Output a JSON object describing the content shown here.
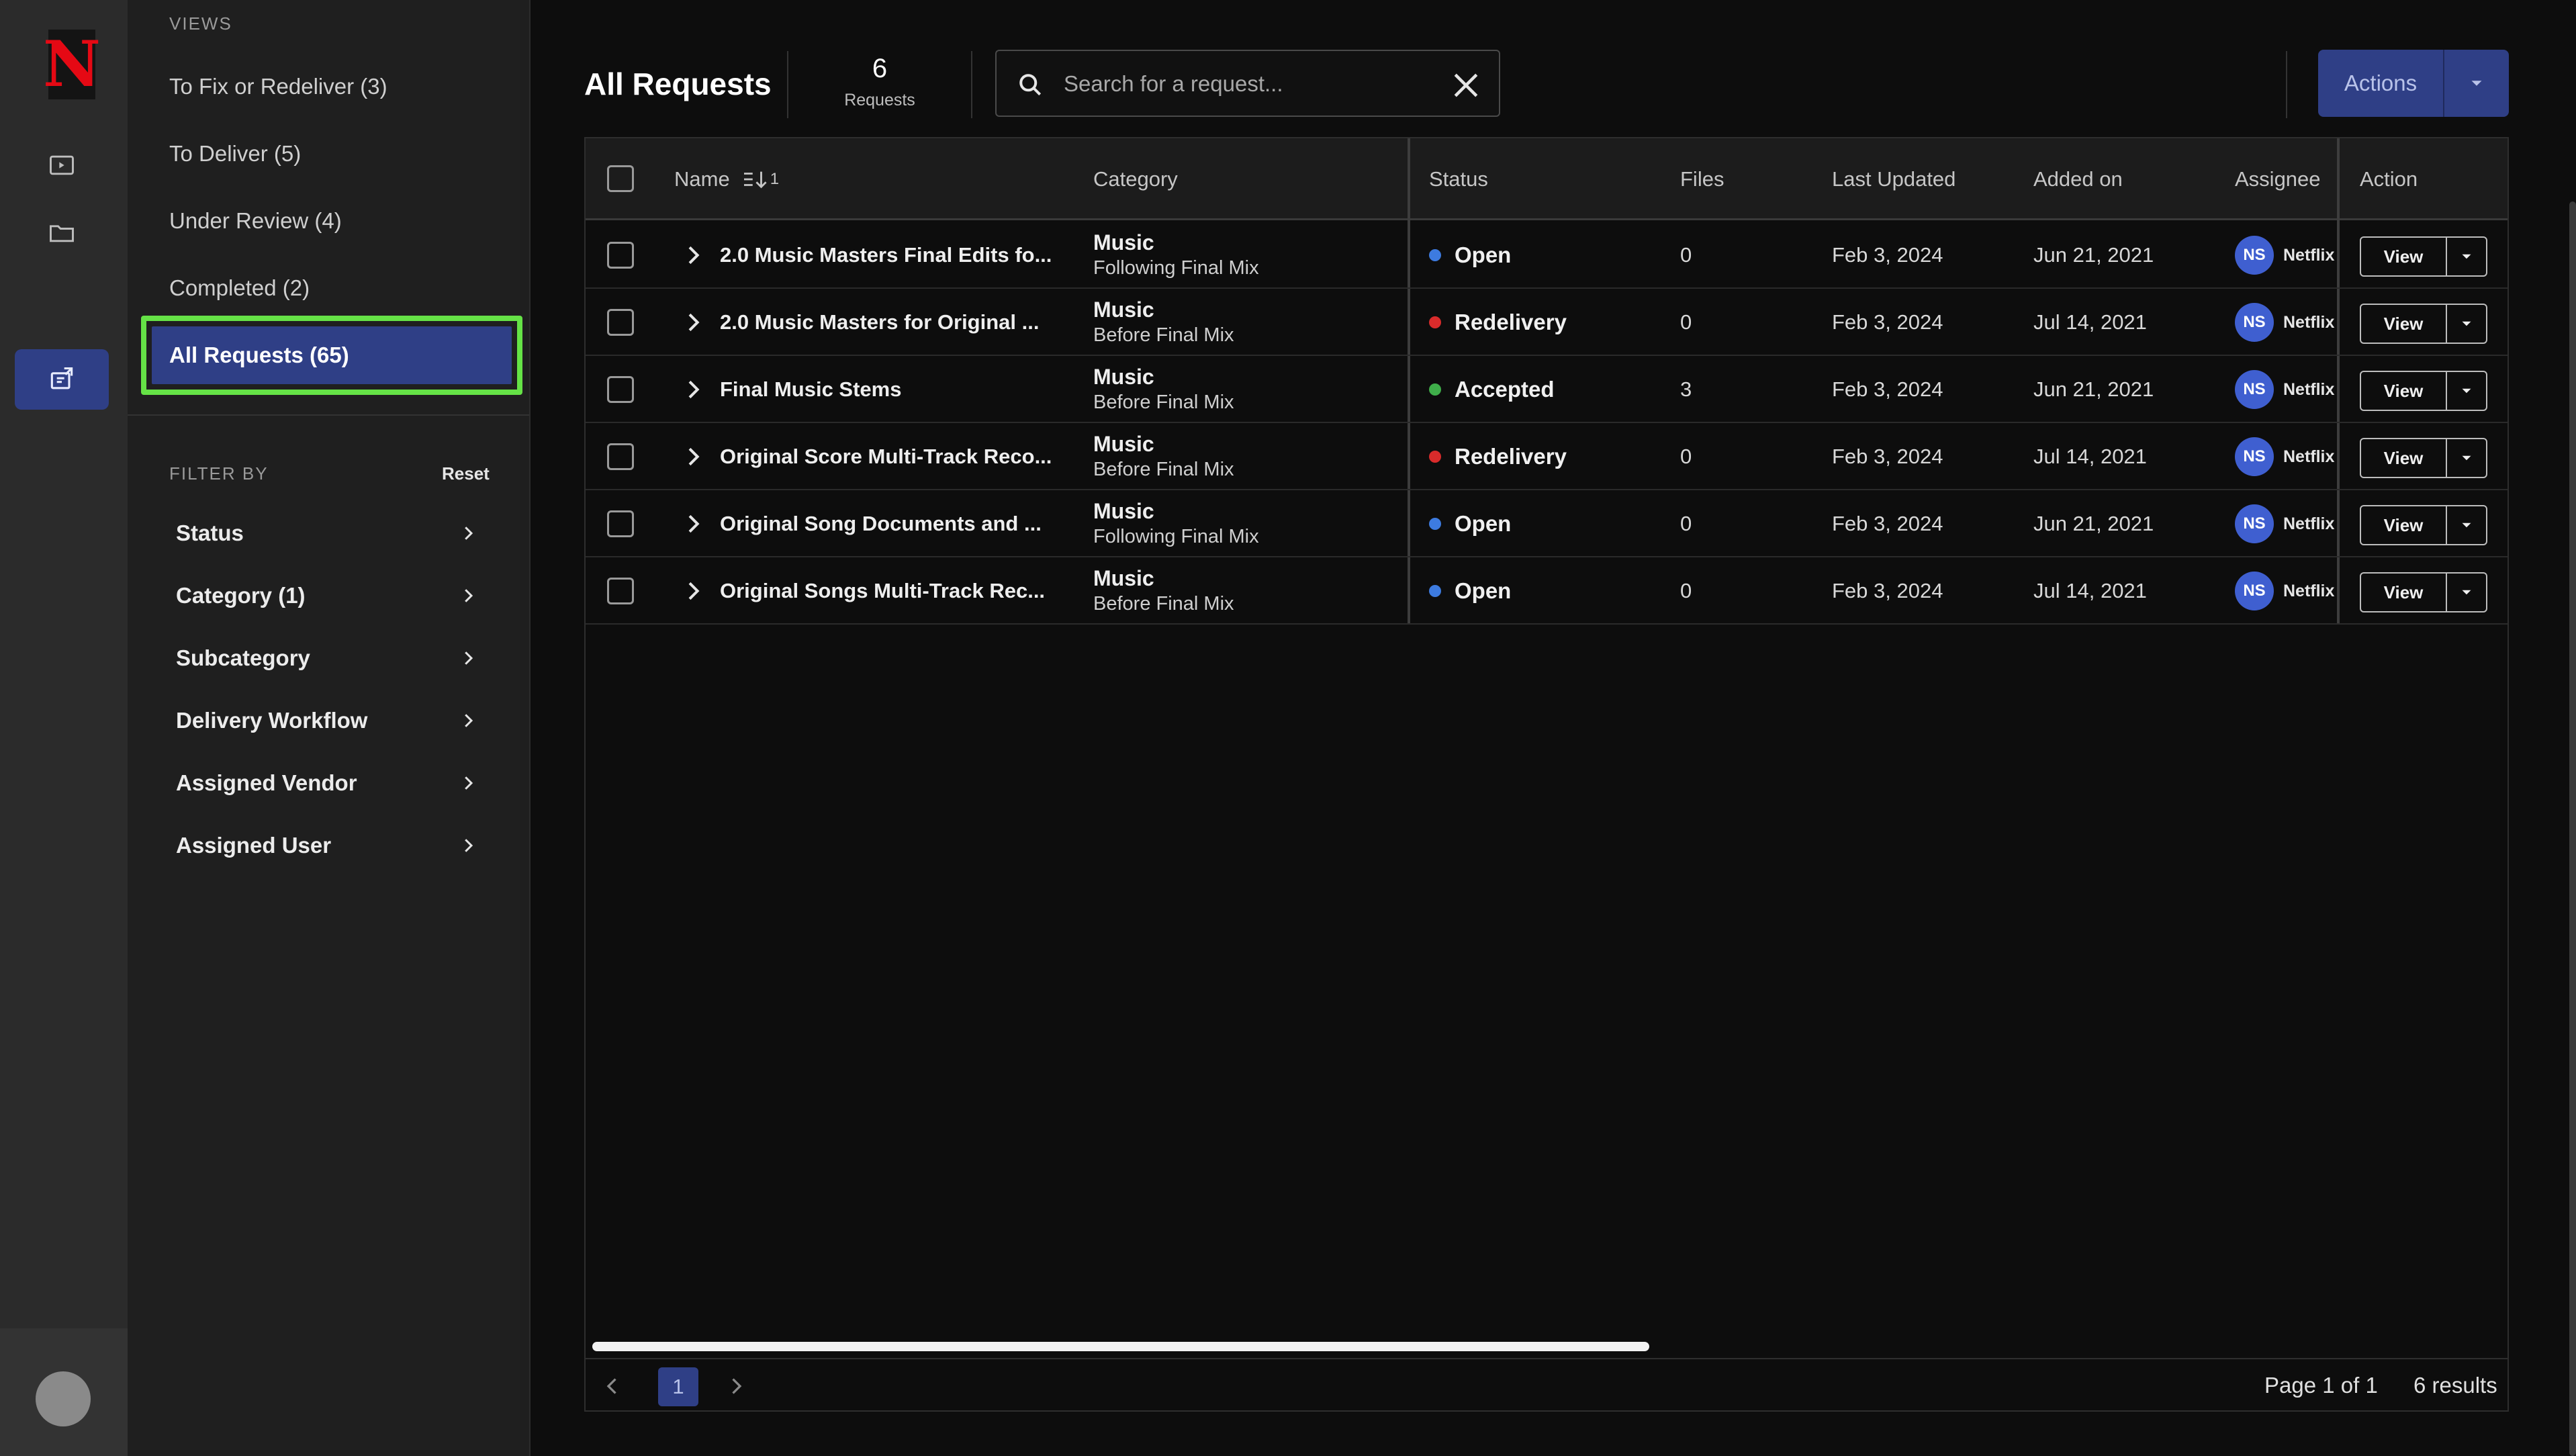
{
  "brand": {
    "logo_letter": "N",
    "accent": "#e50914"
  },
  "rail": {
    "icons": [
      "play-square-icon",
      "folder-icon",
      "requests-icon"
    ],
    "active": "requests-icon"
  },
  "sidebar": {
    "views_label": "VIEWS",
    "views": [
      {
        "label": "To Fix or Redeliver (3)"
      },
      {
        "label": "To Deliver (5)"
      },
      {
        "label": "Under Review (4)"
      },
      {
        "label": "Completed (2)"
      },
      {
        "label": "All Requests (65)",
        "selected": true
      }
    ],
    "filter_label": "FILTER BY",
    "reset_label": "Reset",
    "filters": [
      {
        "label": "Status"
      },
      {
        "label": "Category (1)"
      },
      {
        "label": "Subcategory"
      },
      {
        "label": "Delivery Workflow"
      },
      {
        "label": "Assigned Vendor"
      },
      {
        "label": "Assigned User"
      }
    ]
  },
  "header": {
    "title": "All Requests",
    "count": "6",
    "count_label": "Requests",
    "search_placeholder": "Search for a request...",
    "actions_label": "Actions"
  },
  "table": {
    "columns": {
      "name": "Name",
      "sort_indicator": "1",
      "category": "Category",
      "status": "Status",
      "files": "Files",
      "last_updated": "Last Updated",
      "added_on": "Added on",
      "assignee": "Assignee",
      "action": "Action"
    },
    "view_label": "View",
    "rows": [
      {
        "name": "2.0 Music Masters Final Edits fo...",
        "category": "Music",
        "subcategory": "Following Final Mix",
        "status": "Open",
        "status_color": "#3d7be0",
        "files": "0",
        "last_updated": "Feb 3, 2024",
        "added_on": "Jun 21, 2021",
        "assignee_initials": "NS",
        "assignee_name": "Netflix"
      },
      {
        "name": "2.0 Music Masters for Original ...",
        "category": "Music",
        "subcategory": "Before Final Mix",
        "status": "Redelivery",
        "status_color": "#d92b2b",
        "files": "0",
        "last_updated": "Feb 3, 2024",
        "added_on": "Jul 14, 2021",
        "assignee_initials": "NS",
        "assignee_name": "Netflix"
      },
      {
        "name": "Final Music Stems",
        "category": "Music",
        "subcategory": "Before Final Mix",
        "status": "Accepted",
        "status_color": "#3fae4a",
        "files": "3",
        "last_updated": "Feb 3, 2024",
        "added_on": "Jun 21, 2021",
        "assignee_initials": "NS",
        "assignee_name": "Netflix"
      },
      {
        "name": "Original Score Multi-Track Reco...",
        "category": "Music",
        "subcategory": "Before Final Mix",
        "status": "Redelivery",
        "status_color": "#d92b2b",
        "files": "0",
        "last_updated": "Feb 3, 2024",
        "added_on": "Jul 14, 2021",
        "assignee_initials": "NS",
        "assignee_name": "Netflix"
      },
      {
        "name": "Original Song Documents and ...",
        "category": "Music",
        "subcategory": "Following Final Mix",
        "status": "Open",
        "status_color": "#3d7be0",
        "files": "0",
        "last_updated": "Feb 3, 2024",
        "added_on": "Jun 21, 2021",
        "assignee_initials": "NS",
        "assignee_name": "Netflix"
      },
      {
        "name": "Original Songs Multi-Track Rec...",
        "category": "Music",
        "subcategory": "Before Final Mix",
        "status": "Open",
        "status_color": "#3d7be0",
        "files": "0",
        "last_updated": "Feb 3, 2024",
        "added_on": "Jul 14, 2021",
        "assignee_initials": "NS",
        "assignee_name": "Netflix"
      }
    ]
  },
  "pagination": {
    "current": "1",
    "page_info": "Page 1 of 1",
    "results": "6 results"
  }
}
